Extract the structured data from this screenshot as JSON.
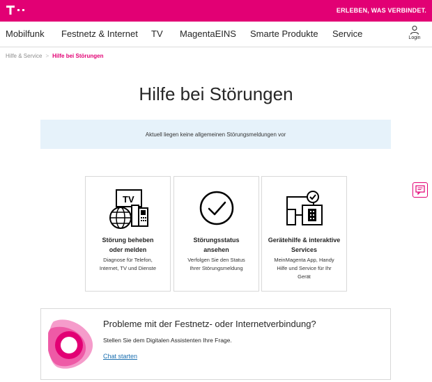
{
  "header": {
    "logo_icon": "telekom-t-logo",
    "slogan": "ERLEBEN, WAS VERBINDET.",
    "brand_color": "#e20074"
  },
  "nav": {
    "items": [
      "Mobilfunk",
      "Festnetz & Internet",
      "TV",
      "MagentaEINS",
      "Smarte Produkte",
      "Service"
    ],
    "login_label": "Login",
    "login_icon": "user-icon"
  },
  "breadcrumb": {
    "home": "Hilfe & Service",
    "separator": ">",
    "current": "Hilfe bei Störungen"
  },
  "page": {
    "title": "Hilfe bei Störungen",
    "info_banner": "Aktuell liegen keine allgemeinen Störungsmeldungen vor"
  },
  "cards": [
    {
      "icon": "tv-phone-globe-icon",
      "icon_text": "TV",
      "title_lines": [
        "Störung beheben",
        "oder melden"
      ],
      "desc_lines": [
        "Diagnose für Telefon,",
        "Internet, TV und Dienste"
      ]
    },
    {
      "icon": "check-circle-icon",
      "title_lines": [
        "Störungsstatus",
        "ansehen"
      ],
      "desc_lines": [
        "Verfolgen Sie den Status",
        "Ihrer Störungsmeldung"
      ]
    },
    {
      "icon": "devices-check-icon",
      "title_lines": [
        "Gerätehilfe & interaktive",
        "Services"
      ],
      "desc_lines": [
        "MeinMagenta App, Handy",
        "Hilfe und Service für Ihr",
        "Gerät"
      ]
    }
  ],
  "chat": {
    "logo_icon": "digital-assistant-logo",
    "title": "Probleme mit der Festnetz- oder Internetverbindung?",
    "subtitle": "Stellen Sie dem Digitalen Assistenten Ihre Frage.",
    "link": "Chat starten",
    "link_color": "#1a6fb0"
  },
  "feedback": {
    "icon": "feedback-chat-icon"
  }
}
